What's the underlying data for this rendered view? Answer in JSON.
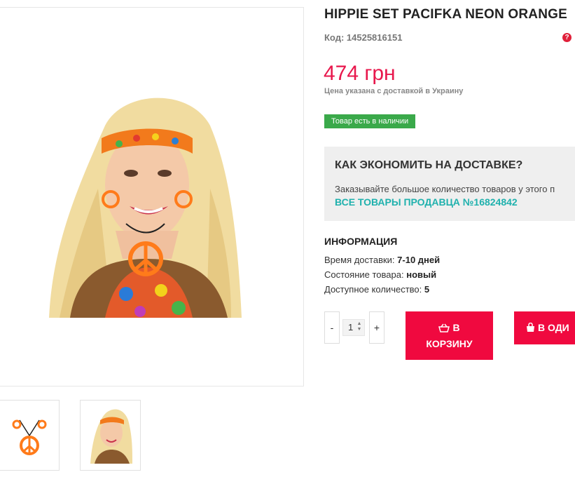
{
  "product": {
    "title": "HIPPIE SET PACIFKA NEON ORANGE",
    "code": "Код: 14525816151",
    "price": "474 грн",
    "price_note": "Цена указана с доставкой в Украину",
    "stock": "Товар есть в наличии"
  },
  "delivery": {
    "title": "КАК ЭКОНОМИТЬ НА ДОСТАВКЕ?",
    "text": "Заказывайте большое количество товаров у этого п",
    "link": "ВСЕ ТОВАРЫ ПРОДАВЦА №16824842"
  },
  "info": {
    "heading": "ИНФОРМАЦИЯ",
    "delivery_time_label": "Время доставки:",
    "delivery_time_value": "7-10 дней",
    "condition_label": "Состояние товара:",
    "condition_value": "новый",
    "available_label": "Доступное количество:",
    "available_value": "5"
  },
  "purchase": {
    "minus": "-",
    "plus": "+",
    "quantity": "1",
    "cart_line1": "В",
    "cart_line2": "КОРЗИНУ",
    "one_click": "В ОДИ"
  },
  "colors": {
    "price": "#e8174c",
    "accent_button": "#f0093f",
    "stock_badge": "#3aa94a",
    "link": "#1fb1ad"
  },
  "icons": [
    "help-icon",
    "basket-icon",
    "bag-icon",
    "spinner-arrows-icon"
  ]
}
